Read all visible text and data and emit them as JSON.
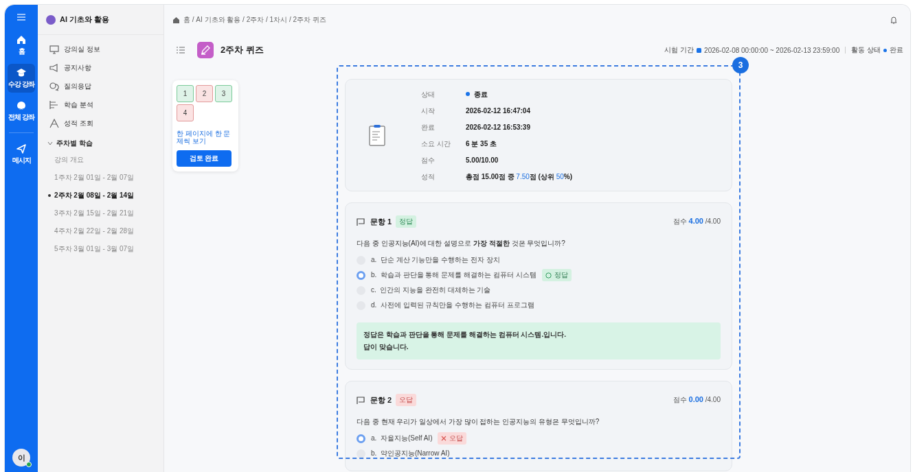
{
  "rail": {
    "items": [
      {
        "kind": "home",
        "label": "홈",
        "selected": false
      },
      {
        "kind": "courses",
        "label": "수강 강좌",
        "selected": true
      },
      {
        "kind": "all",
        "label": "전체 강좌",
        "selected": false
      },
      {
        "kind": "message",
        "label": "메시지",
        "selected": false
      }
    ],
    "avatar": "이"
  },
  "sidebar": {
    "course_title": "AI 기초와 활용",
    "menu": [
      {
        "kind": "monitor",
        "label": "강의실 정보"
      },
      {
        "kind": "megaphone",
        "label": "공지사항"
      },
      {
        "kind": "chat",
        "label": "질의응답"
      },
      {
        "kind": "chart",
        "label": "학습 분석"
      },
      {
        "kind": "grade",
        "label": "성적 조회"
      }
    ],
    "section": {
      "label": "주차별 학습",
      "expanded": true,
      "items": [
        {
          "label": "강의 개요",
          "selected": false
        },
        {
          "label": "1주차 2월 01일 - 2월 07일",
          "selected": false
        },
        {
          "label": "2주차 2월 08일 - 2월 14일",
          "selected": true
        },
        {
          "label": "3주차 2월 15일 - 2월 21일",
          "selected": false
        },
        {
          "label": "4주차 2월 22일 - 2월 28일",
          "selected": false
        },
        {
          "label": "5주차 3월 01일 - 3월 07일",
          "selected": false
        }
      ]
    }
  },
  "breadcrumb": "홈 / AI 기초와 활용 / 2주차 / 1차시 / 2주차 퀴즈",
  "page_title": "2주차 퀴즈",
  "exam_period": {
    "label": "시험 기간",
    "value": "2026-02-08 00:00:00 ~ 2026-02-13 23:59:00"
  },
  "activity_status": {
    "label": "활동 상태",
    "value": "완료"
  },
  "quiz_nav": {
    "questions": [
      {
        "number": "1",
        "correct": true
      },
      {
        "number": "2",
        "correct": false
      },
      {
        "number": "3",
        "correct": true
      },
      {
        "number": "4",
        "correct": false
      }
    ],
    "link": "한 페이지에 한 문제씩 보기",
    "button": "검토 완료"
  },
  "step_badge": "3",
  "summary": [
    {
      "label": "상태",
      "kind": "status",
      "parts": [
        {
          "text": "종료",
          "highlight": false
        }
      ]
    },
    {
      "label": "시작",
      "kind": "text",
      "parts": [
        {
          "text": "2026-02-12 16:47:04",
          "highlight": false
        }
      ]
    },
    {
      "label": "완료",
      "kind": "text",
      "parts": [
        {
          "text": "2026-02-12 16:53:39",
          "highlight": false
        }
      ]
    },
    {
      "label": "소요 시간",
      "kind": "text",
      "parts": [
        {
          "text": "6 분 35 초",
          "highlight": false
        }
      ]
    },
    {
      "label": "점수",
      "kind": "text",
      "parts": [
        {
          "text": "5.00/10.00",
          "highlight": false
        }
      ]
    },
    {
      "label": "성적",
      "kind": "text",
      "parts": [
        {
          "text": "총점 15.00점 중 ",
          "highlight": false
        },
        {
          "text": "7.50",
          "highlight": true
        },
        {
          "text": "점 (상위 ",
          "highlight": false
        },
        {
          "text": "50",
          "highlight": true
        },
        {
          "text": "%)",
          "highlight": false
        }
      ]
    }
  ],
  "questions": [
    {
      "title": "문항 1",
      "result": "정답",
      "correct": true,
      "score_label": "점수",
      "score": "4.00",
      "max": "/4.00",
      "text": "다음 중 인공지능(AI)에 대한 설명으로 **가장 적절한** 것은 무엇입니까?",
      "options": [
        {
          "letter": "a.",
          "text": "단순 계산 기능만을 수행하는 전자 장치",
          "selected": false
        },
        {
          "letter": "b.",
          "text": "학습과 판단을 통해 문제를 해결하는 컴퓨터 시스템",
          "selected": true,
          "tag": {
            "kind": "correct",
            "label": "정답"
          }
        },
        {
          "letter": "c.",
          "text": "인간의 지능을 완전히 대체하는 기술",
          "selected": false
        },
        {
          "letter": "d.",
          "text": "사전에 입력된 규칙만을 수행하는 컴퓨터 프로그램",
          "selected": false
        }
      ],
      "feedback": [
        "정답은 학습과 판단을 통해 문제를 해결하는 컴퓨터 시스템.입니다.",
        "답이 맞습니다."
      ]
    },
    {
      "title": "문항 2",
      "result": "오답",
      "correct": false,
      "score_label": "점수",
      "score": "0.00",
      "max": "/4.00",
      "text": "다음 중 현재 우리가 일상에서 가장 많이 접하는 인공지능의 유형은 무엇입니까?",
      "options": [
        {
          "letter": "a.",
          "text": "자율지능(Self AI)",
          "selected": true,
          "tag": {
            "kind": "wrong",
            "label": "오답"
          }
        },
        {
          "letter": "b.",
          "text": "약인공지능(Narrow AI)",
          "selected": false
        }
      ]
    }
  ]
}
